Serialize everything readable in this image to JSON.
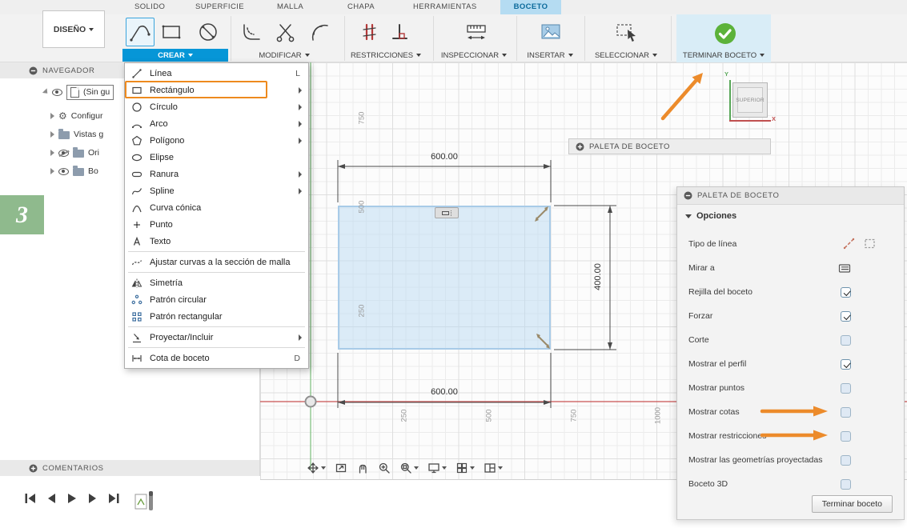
{
  "colors": {
    "accent_blue": "#0696d7",
    "active_tab_blue": "#b5dcf2",
    "finish_green": "#5cb23a",
    "highlight_orange": "#ee8a1e",
    "annotation_orange": "#ec8b2b",
    "axis_red": "#c95252",
    "axis_green": "#7cbf7c",
    "badge_green": "#8fba8d"
  },
  "tabs": {
    "items": [
      {
        "label": "SOLIDO"
      },
      {
        "label": "SUPERFICIE"
      },
      {
        "label": "MALLA"
      },
      {
        "label": "CHAPA"
      },
      {
        "label": "HERRAMIENTAS"
      },
      {
        "label": "BOCETO",
        "active": true
      }
    ]
  },
  "design_menu": {
    "label": "DISEÑO"
  },
  "toolbar": {
    "groups": [
      {
        "label": "CREAR"
      },
      {
        "label": "MODIFICAR"
      },
      {
        "label": "RESTRICCIONES"
      },
      {
        "label": "INSPECCIONAR"
      },
      {
        "label": "INSERTAR"
      },
      {
        "label": "SELECCIONAR"
      },
      {
        "label": "TERMINAR BOCETO"
      }
    ]
  },
  "create_menu": {
    "items": [
      {
        "label": "Línea",
        "shortcut": "L",
        "icon": "line-icon"
      },
      {
        "label": "Rectángulo",
        "submenu": true,
        "highlighted": true,
        "icon": "rectangle-icon"
      },
      {
        "label": "Círculo",
        "submenu": true,
        "icon": "circle-icon"
      },
      {
        "label": "Arco",
        "submenu": true,
        "icon": "arc-icon"
      },
      {
        "label": "Polígono",
        "submenu": true,
        "icon": "polygon-icon"
      },
      {
        "label": "Elipse",
        "icon": "ellipse-icon"
      },
      {
        "label": "Ranura",
        "submenu": true,
        "icon": "slot-icon"
      },
      {
        "label": "Spline",
        "submenu": true,
        "icon": "spline-icon"
      },
      {
        "label": "Curva cónica",
        "icon": "conic-icon"
      },
      {
        "label": "Punto",
        "icon": "point-icon"
      },
      {
        "label": "Texto",
        "icon": "text-icon"
      },
      {
        "label": "Ajustar curvas a la sección de malla",
        "icon": "fit-curves-icon"
      },
      {
        "label": "Simetría",
        "icon": "mirror-icon"
      },
      {
        "label": "Patrón circular",
        "icon": "circular-pattern-icon"
      },
      {
        "label": "Patrón rectangular",
        "icon": "rectangular-pattern-icon"
      },
      {
        "label": "Proyectar/Incluir",
        "submenu": true,
        "icon": "project-icon"
      },
      {
        "label": "Cota de boceto",
        "shortcut": "D",
        "icon": "dimension-icon"
      }
    ]
  },
  "navigator": {
    "title": "NAVEGADOR",
    "items": [
      {
        "label": "(Sin gu"
      },
      {
        "label": "Configur"
      },
      {
        "label": "Vistas g"
      },
      {
        "label": "Ori"
      },
      {
        "label": "Bo"
      }
    ],
    "comments_label": "COMENTARIOS"
  },
  "canvas": {
    "dimensions": {
      "top": "600.00",
      "right": "400.00",
      "bottom": "600.00"
    },
    "ruler_vertical": [
      "750",
      "500",
      "250"
    ],
    "ruler_horizontal": [
      "250",
      "500",
      "750",
      "1000"
    ],
    "viewcube": {
      "label": "SUPERIOR",
      "axis_x": "X",
      "axis_y": "Y"
    }
  },
  "palette_bar": {
    "title": "PALETA DE BOCETO"
  },
  "sketch_palette": {
    "title": "PALETA DE BOCETO",
    "section": "Opciones",
    "rows": [
      {
        "label": "Tipo de línea",
        "control": "linetype-icons"
      },
      {
        "label": "Mirar a",
        "control": "look-at-icon"
      },
      {
        "label": "Rejilla del boceto",
        "control": "checkbox",
        "checked": true
      },
      {
        "label": "Forzar",
        "control": "checkbox",
        "checked": true
      },
      {
        "label": "Corte",
        "control": "checkbox",
        "checked": false
      },
      {
        "label": "Mostrar el perfil",
        "control": "checkbox",
        "checked": true
      },
      {
        "label": "Mostrar puntos",
        "control": "checkbox",
        "checked": false
      },
      {
        "label": "Mostrar cotas",
        "control": "checkbox",
        "checked": false,
        "annotated": true
      },
      {
        "label": "Mostrar restricciones",
        "control": "checkbox",
        "checked": false,
        "annotated": true
      },
      {
        "label": "Mostrar las geometrías proyectadas",
        "control": "checkbox",
        "checked": false
      },
      {
        "label": "Boceto 3D",
        "control": "checkbox",
        "checked": false
      }
    ],
    "finish_button": "Terminar boceto"
  },
  "annotation": {
    "figure_number": "3"
  },
  "icons": {
    "gear": "⚙"
  }
}
